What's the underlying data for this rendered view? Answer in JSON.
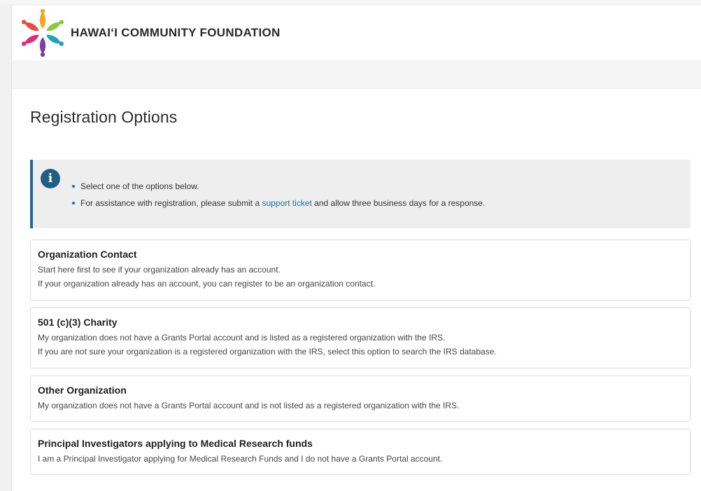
{
  "header": {
    "org_name": "HAWAIʻI COMMUNITY FOUNDATION",
    "logo_icon": "hcf-flower-logo"
  },
  "main": {
    "title": "Registration Options",
    "info": {
      "icon": "info-icon",
      "bullet1": "Select one of the options below.",
      "bullet2_before": "For assistance with registration, please submit a ",
      "bullet2_link": "support ticket",
      "bullet2_after": " and allow three business days for a response."
    },
    "options": [
      {
        "title": "Organization Contact",
        "lines": [
          "Start here first to see if your organization already has an account.",
          "If your organization already has an account, you can register to be an organization contact."
        ]
      },
      {
        "title": "501 (c)(3) Charity",
        "lines": [
          "My organization does not have a Grants Portal account and is listed as a registered organization with the IRS.",
          "If you are not sure your organization is a registered organization with the IRS, select this option to search the IRS database."
        ]
      },
      {
        "title": "Other Organization",
        "lines": [
          "My organization does not have a Grants Portal account and is not listed as a registered organization with the IRS."
        ]
      },
      {
        "title": "Principal Investigators applying to Medical Research funds",
        "lines": [
          "I am a Principal Investigator applying for Medical Research Funds and I do not have a Grants Portal account."
        ]
      }
    ]
  },
  "colors": {
    "accent": "#1c6b94",
    "link": "#1d6fa5",
    "info_bg": "#eeeeee"
  }
}
